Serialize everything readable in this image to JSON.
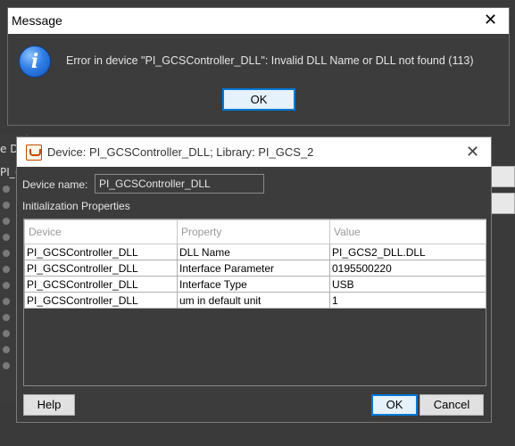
{
  "background": {
    "left_label_1": "e D",
    "left_label_2": "PI_("
  },
  "message_dialog": {
    "title": "Message",
    "close_glyph": "✕",
    "icon": "info-icon",
    "icon_glyph": "i",
    "text": "Error in device \"PI_GCSController_DLL\": Invalid DLL Name or DLL not found (113)",
    "ok_label": "OK"
  },
  "device_dialog": {
    "title": "Device: PI_GCSController_DLL; Library: PI_GCS_2",
    "close_glyph": "✕",
    "device_name_label": "Device name:",
    "device_name_value": "PI_GCSController_DLL",
    "section_label": "Initialization Properties",
    "table": {
      "columns": [
        "Device",
        "Property",
        "Value"
      ],
      "rows": [
        [
          "PI_GCSController_DLL",
          "DLL Name",
          "PI_GCS2_DLL.DLL"
        ],
        [
          "PI_GCSController_DLL",
          "Interface Parameter",
          "0195500220"
        ],
        [
          "PI_GCSController_DLL",
          "Interface Type",
          "USB"
        ],
        [
          "PI_GCSController_DLL",
          "um in default unit",
          "1"
        ]
      ]
    },
    "help_label": "Help",
    "ok_label": "OK",
    "cancel_label": "Cancel"
  }
}
